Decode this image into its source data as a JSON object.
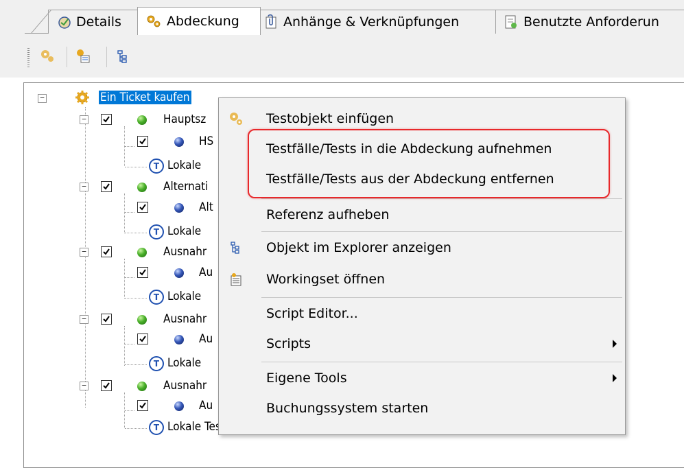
{
  "tabs": [
    {
      "label": "Details",
      "icon": "details-icon",
      "active": false
    },
    {
      "label": "Abdeckung",
      "icon": "coverage-icon",
      "active": true
    },
    {
      "label": "Anhänge & Verknüpfungen",
      "icon": "attachment-icon",
      "active": false
    },
    {
      "label": "Benutzte Anforderun",
      "icon": "requirements-icon",
      "active": false
    }
  ],
  "toolbar": {
    "buttons": [
      "insert-test-object-icon",
      "add-coverage-icon",
      "tree-view-icon"
    ]
  },
  "tree": {
    "root": {
      "label": "Ein Ticket kaufen",
      "selected": true
    },
    "groups": [
      {
        "label": "Hauptsz",
        "child": "HS",
        "tests": "Lokale"
      },
      {
        "label": "Alternati",
        "child": "Alt",
        "tests": "Lokale"
      },
      {
        "label": "Ausnahr",
        "child": "Au",
        "tests": "Lokale"
      },
      {
        "label": "Ausnahr",
        "child": "Au",
        "tests": "Lokale"
      },
      {
        "label": "Ausnahr",
        "child": "Au",
        "tests": "Lokale Tests"
      }
    ]
  },
  "context_menu": {
    "items": [
      {
        "id": "insert-test-object",
        "label": "Testobjekt einfügen",
        "icon": "gear-icon"
      },
      {
        "id": "add-to-coverage",
        "label": "Testfälle/Tests in die Abdeckung aufnehmen"
      },
      {
        "id": "remove-from-coverage",
        "label": "Testfälle/Tests aus der Abdeckung entfernen"
      },
      {
        "id": "remove-reference",
        "label": "Referenz aufheben"
      },
      {
        "id": "show-in-explorer",
        "label": "Objekt im Explorer anzeigen",
        "icon": "tree-icon"
      },
      {
        "id": "open-workingset",
        "label": "Workingset öffnen",
        "icon": "workingset-icon"
      },
      {
        "id": "script-editor",
        "label": "Script Editor..."
      },
      {
        "id": "scripts",
        "label": "Scripts",
        "submenu": true
      },
      {
        "id": "own-tools",
        "label": "Eigene Tools",
        "submenu": true
      },
      {
        "id": "start-booking-system",
        "label": "Buchungssystem starten"
      }
    ]
  },
  "colors": {
    "selection": "#0078d7",
    "highlight_border": "#e8282b",
    "menu_bg": "#f2f2f2"
  }
}
